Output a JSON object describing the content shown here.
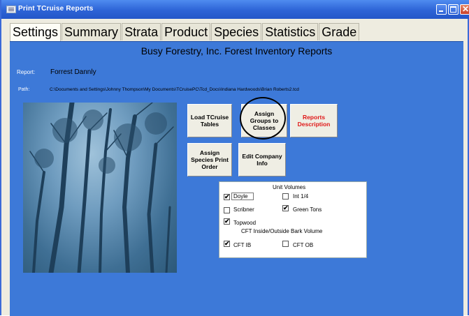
{
  "window": {
    "title": "Print TCruise Reports"
  },
  "tabs": [
    "Settings",
    "Summary",
    "Strata",
    "Product",
    "Species",
    "Statistics",
    "Grade"
  ],
  "active_tab": "Settings",
  "heading": "Busy Forestry, Inc. Forest Inventory Reports",
  "report": {
    "label": "Report:",
    "value": "Forrest Dannly"
  },
  "path": {
    "label": "Path:",
    "value": "C:\\Documents and Settings\\Johnny Thompson\\My Documents\\TCruisePC\\Tcd_Docs\\Indiana Hardwoods\\Brian Roberts2.tcd"
  },
  "buttons": {
    "load": "Load TCruise Tables",
    "assign_groups": "Assign Groups to Classes",
    "reports_desc": "Reports Description",
    "assign_species": "Assign Species Print Order",
    "edit_company": "Edit Company Info"
  },
  "unit_volumes": {
    "title": "Unit Volumes",
    "items": [
      {
        "label": "Doyle",
        "checked": true
      },
      {
        "label": "Int 1/4",
        "checked": false
      },
      {
        "label": "Scribner",
        "checked": false
      },
      {
        "label": "Green Tons",
        "checked": true
      },
      {
        "label": "Topwood",
        "checked": true
      }
    ],
    "cft_title": "CFT Inside/Outside Bark Volume",
    "cft": [
      {
        "label": "CFT IB",
        "checked": true
      },
      {
        "label": "CFT OB",
        "checked": false
      }
    ]
  },
  "colors": {
    "panel": "#3d79d8",
    "title_bar": "#2d63d6",
    "reports_desc_text": "#e01818"
  }
}
